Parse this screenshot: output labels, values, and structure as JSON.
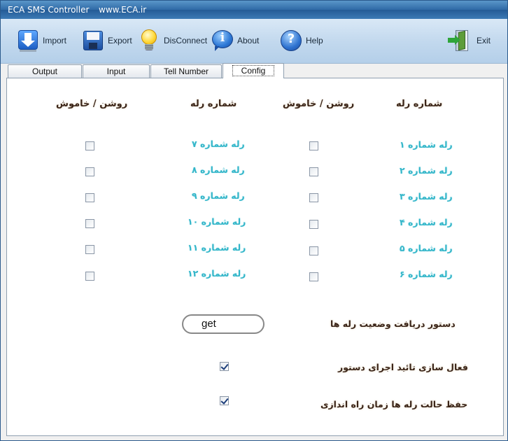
{
  "titlebar": {
    "app": "ECA SMS Controller",
    "site": "www.ECA.ir"
  },
  "toolbar": {
    "import": "Import",
    "export": "Export",
    "disconnect": "DisConnect",
    "about": "About",
    "help": "Help",
    "exit": "Exit"
  },
  "tabs": [
    "Output",
    "Input",
    "Tell Number",
    "Config"
  ],
  "active_tab": "Config",
  "config": {
    "headers": {
      "relay_number": "شماره رله",
      "on_off": "روشن / خاموش"
    },
    "relays_right": [
      "رله شماره ۱",
      "رله شماره ۲",
      "رله شماره ۳",
      "رله شماره ۴",
      "رله شماره ۵",
      "رله شماره ۶"
    ],
    "relays_left": [
      "رله شماره ۷",
      "رله شماره ۸",
      "رله شماره ۹",
      "رله شماره ۱۰",
      "رله شماره ۱۱",
      "رله شماره ۱۲"
    ],
    "status_command_label": "دستور دریافت وضعیت رله ها",
    "status_command_value": "get",
    "confirm_label": "فعال سازی تائید اجرای دستور",
    "confirm_checked": true,
    "save_state_label": "حفظ حالت رله ها زمان راه اندازی",
    "save_state_checked": true
  }
}
